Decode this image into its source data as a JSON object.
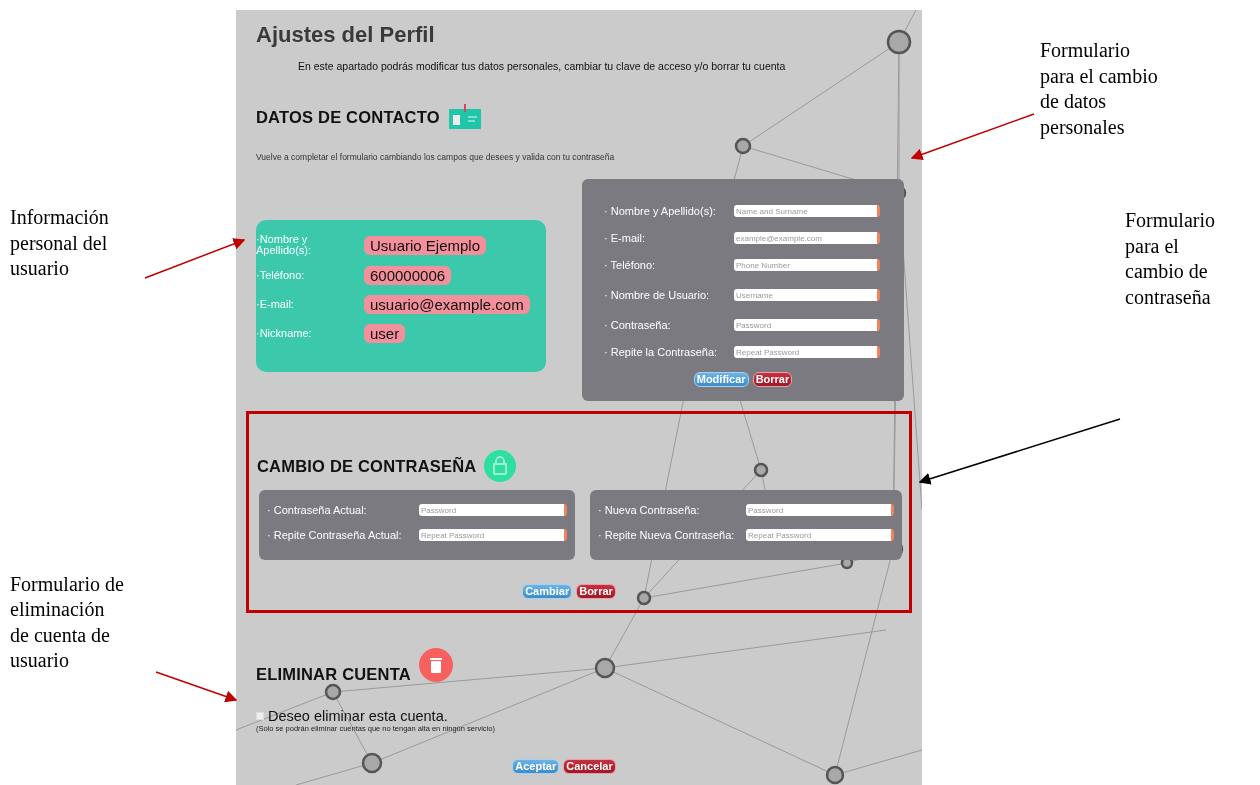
{
  "profile_page": {
    "title": "Ajustes del Perfil",
    "intro": "En este apartado podrás modificar tus datos personales, cambiar tu clave de acceso y/o borrar tu cuenta"
  },
  "contact": {
    "heading": "DATOS DE CONTACTO",
    "hint": "Vuelve a completar el formulario cambiando los campos que desees y valida con tu contraseña",
    "profile": [
      {
        "label": "·Nombre y Apellido(s):",
        "value": "Usuario Ejemplo"
      },
      {
        "label": "·Teléfono:",
        "value": "600000006"
      },
      {
        "label": "·E-mail:",
        "value": "usuario@example.com"
      },
      {
        "label": "·Nickname:",
        "value": "user"
      }
    ],
    "form": {
      "fields": [
        {
          "label": "· Nombre y Apellido(s):",
          "placeholder": "Name and Surname"
        },
        {
          "label": "· E-mail:",
          "placeholder": "example@example.com"
        },
        {
          "label": "· Teléfono:",
          "placeholder": "Phone Number"
        },
        {
          "label": "· Nombre de Usuario:",
          "placeholder": "Username"
        },
        {
          "label": "· Contraseña:",
          "placeholder": "Password"
        },
        {
          "label": "· Repite la Contraseña:",
          "placeholder": "Repeat Password"
        }
      ],
      "buttons": [
        {
          "label": "Modificar",
          "kind": "primary"
        },
        {
          "label": "Borrar",
          "kind": "danger"
        }
      ]
    }
  },
  "password": {
    "heading": "CAMBIO DE CONTRASEÑA",
    "groups": [
      {
        "fields": [
          {
            "label": "· Contraseña Actual:",
            "placeholder": "Password"
          },
          {
            "label": "· Repite Contraseña Actual:",
            "placeholder": "Repeat Password"
          }
        ]
      },
      {
        "fields": [
          {
            "label": "· Nueva Contraseña:",
            "placeholder": "Password"
          },
          {
            "label": "· Repite Nueva Contraseña:",
            "placeholder": "Repeat Password"
          }
        ]
      }
    ],
    "buttons": [
      {
        "label": "Cambiar",
        "kind": "primary"
      },
      {
        "label": "Borrar",
        "kind": "danger"
      }
    ]
  },
  "delete_account": {
    "heading": "ELIMINAR CUENTA",
    "checkbox": {
      "label": "Deseo eliminar esta cuenta.",
      "checked": false
    },
    "note": "(Solo se podrán eliminar cuentas que no tengan alta en ningún servicio)",
    "buttons": [
      {
        "label": "Aceptar",
        "kind": "primary"
      },
      {
        "label": "Cancelar",
        "kind": "danger"
      }
    ]
  },
  "annotations": [
    {
      "text": "Información\npersonal del\nusuario"
    },
    {
      "text": "Formulario de\neliminación\nde cuenta de\nusuario"
    },
    {
      "text": "Formulario\npara el cambio\nde datos\npersonales"
    },
    {
      "text": "Formulario\npara el\ncambio de\ncontraseña"
    }
  ]
}
